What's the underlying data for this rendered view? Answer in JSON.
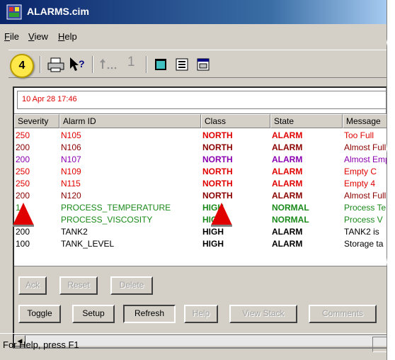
{
  "window": {
    "title": "ALARMS.cim"
  },
  "menu": {
    "file": "ile",
    "file_hot": "F",
    "view": "iew",
    "view_hot": "V",
    "help": "elp",
    "help_hot": "H"
  },
  "toolbar": {
    "step_badge": "4",
    "arrow_label": "1",
    "icons": [
      "print-icon",
      "context-help-icon",
      "back-arrow-icon",
      "view-window-icon",
      "view-list-icon",
      "view-details-icon"
    ]
  },
  "date_line": "10 Apr 28 17:46",
  "columns": [
    "Severity",
    "Alarm ID",
    "Class",
    "State",
    "Message"
  ],
  "rows": [
    {
      "severity": "250",
      "id": "N105",
      "class": "NORTH",
      "state": "ALARM",
      "message": "Too Full",
      "color": "#e00000"
    },
    {
      "severity": "200",
      "id": "N106",
      "class": "NORTH",
      "state": "ALARM",
      "message": "Almost Full",
      "color": "#8b0000"
    },
    {
      "severity": "200",
      "id": "N107",
      "class": "NORTH",
      "state": "ALARM",
      "message": "Almost Empty",
      "color": "#8a00b0"
    },
    {
      "severity": "250",
      "id": "N109",
      "class": "NORTH",
      "state": "ALARM",
      "message": "Empty   C",
      "color": "#e00000"
    },
    {
      "severity": "250",
      "id": "N115",
      "class": "NORTH",
      "state": "ALARM",
      "message": "Empty   4",
      "color": "#e00000"
    },
    {
      "severity": "200",
      "id": "N120",
      "class": "NORTH",
      "state": "ALARM",
      "message": "Almost Full",
      "color": "#8b0000"
    },
    {
      "severity": "1",
      "id": "PROCESS_TEMPERATURE",
      "class": "HIGH",
      "state": "NORMAL",
      "message": "Process Te",
      "color": "#1a8a1a"
    },
    {
      "severity": "1",
      "id": "PROCESS_VISCOSITY",
      "class": "HIGH",
      "state": "NORMAL",
      "message": "Process V",
      "color": "#1a8a1a"
    },
    {
      "severity": "200",
      "id": "TANK2",
      "class": "HIGH",
      "state": "ALARM",
      "message": "TANK2 is",
      "color": "#000000"
    },
    {
      "severity": "100",
      "id": "TANK_LEVEL",
      "class": "HIGH",
      "state": "ALARM",
      "message": "Storage ta",
      "color": "#000000"
    }
  ],
  "buttons": {
    "ack": "Ack",
    "reset": "Reset",
    "delete": "Delete",
    "toggle": "Toggle",
    "setup": "Setup",
    "refresh": "Refresh",
    "help": "Help",
    "view_stack": "View Stack",
    "comments": "Comments"
  },
  "status": "For Help, press F1",
  "colors": {
    "alarm_red": "#e00000",
    "alarm_dark_red": "#8b0000",
    "alarm_purple": "#8a00b0",
    "normal_green": "#1a8a1a",
    "marker_red": "#e00000"
  }
}
